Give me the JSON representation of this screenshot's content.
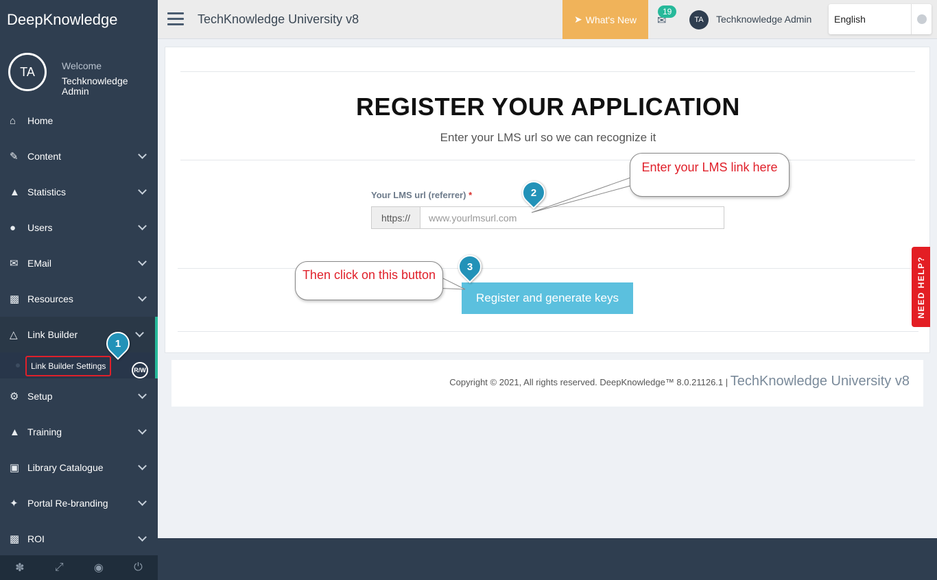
{
  "sidebar": {
    "brand": "DeepKnowledge",
    "avatar_initials": "TA",
    "welcome": "Welcome",
    "user_name": "Techknowledge Admin",
    "items": [
      {
        "label": "Home",
        "icon": "home-icon"
      },
      {
        "label": "Content",
        "icon": "edit-icon"
      },
      {
        "label": "Statistics",
        "icon": "area-chart-icon"
      },
      {
        "label": "Users",
        "icon": "users-icon"
      },
      {
        "label": "EMail",
        "icon": "envelope-icon"
      },
      {
        "label": "Resources",
        "icon": "puzzle-icon"
      },
      {
        "label": "Link Builder",
        "icon": "flask-icon"
      },
      {
        "label": "Setup",
        "icon": "gears-icon"
      },
      {
        "label": "Training",
        "icon": "graduation-cap-icon"
      },
      {
        "label": "Library Catalogue",
        "icon": "book-icon"
      },
      {
        "label": "Portal Re-branding",
        "icon": "magic-wand-icon"
      },
      {
        "label": "ROI",
        "icon": "money-icon"
      }
    ],
    "sub_item": "Link Builder Settings",
    "rw_badge": "R/W",
    "footer_icons": [
      "bug-icon",
      "fullscreen-icon",
      "hide-icon",
      "power-icon"
    ]
  },
  "topbar": {
    "title": "TechKnowledge University v8",
    "whats_new": "What's New",
    "mail_badge": "19",
    "avatar_initials": "TA",
    "user_name": "Techknowledge Admin",
    "language": "English"
  },
  "main": {
    "heading": "REGISTER YOUR APPLICATION",
    "subheading": "Enter your LMS url so we can recognize it",
    "field_label": "Your LMS url (referrer)",
    "required_mark": "*",
    "url_prefix": "https://",
    "url_placeholder": "www.yourlmsurl.com",
    "register_button": "Register and generate keys"
  },
  "help_tab": "NEED HELP?",
  "footer": {
    "copyright": "Copyright © 2021, All rights reserved. DeepKnowledge™ 8.0.21126.1 |",
    "version": "TechKnowledge University v8"
  },
  "annotations": {
    "callout_link": "Enter your LMS link here",
    "callout_button": "Then click on this button",
    "pin1": "1",
    "pin2": "2",
    "pin3": "3"
  },
  "colors": {
    "sidebar": "#2f3e50",
    "accent_green": "#26b99a",
    "whats_new": "#f0b35a",
    "button": "#5bc0de",
    "help_tab": "#e31e24"
  }
}
